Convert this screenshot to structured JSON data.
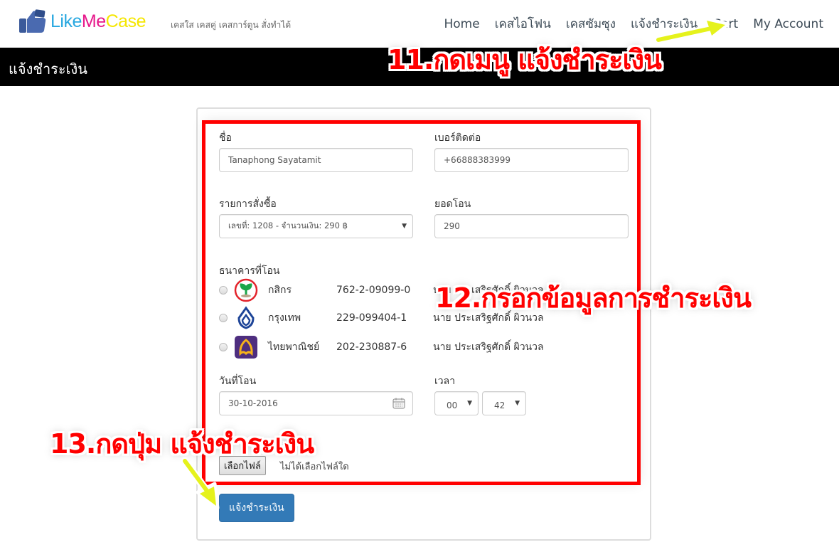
{
  "header": {
    "logo": {
      "part1": "Like",
      "part2": "Me",
      "part3": "Case"
    },
    "tagline": "เคสใส เคสคู่ เคสการ์ตูน สั่งทำได้",
    "nav": [
      {
        "label": "Home"
      },
      {
        "label": "เคสไอโฟน"
      },
      {
        "label": "เคสซัมซุง"
      },
      {
        "label": "แจ้งชำระเงิน"
      },
      {
        "label": "Cart"
      },
      {
        "label": "My Account"
      }
    ]
  },
  "page_title": "แจ้งชำระเงิน",
  "form": {
    "name": {
      "label": "ชื่อ",
      "value": "Tanaphong Sayatamit"
    },
    "phone": {
      "label": "เบอร์ติดต่อ",
      "value": "+66888383999"
    },
    "order": {
      "label": "รายการสั่งซื้อ",
      "selected": "เลขที่: 1208 - จำนวนเงิน: 290 ฿"
    },
    "amount": {
      "label": "ยอดโอน",
      "value": "290"
    },
    "bank": {
      "label": "ธนาคารที่โอน",
      "options": [
        {
          "name": "กสิกร",
          "account": "762-2-09099-0",
          "owner": "นาย ประเสริฐศักดิ์ ผิวนวล",
          "icon": "kbank-logo-icon",
          "color": "#1ba549"
        },
        {
          "name": "กรุงเทพ",
          "account": "229-099404-1",
          "owner": "นาย ประเสริฐศักดิ์ ผิวนวล",
          "icon": "bbl-logo-icon",
          "color": "#1e4598"
        },
        {
          "name": "ไทยพาณิชย์",
          "account": "202-230887-6",
          "owner": "นาย ประเสริฐศักดิ์ ผิวนวล",
          "icon": "scb-logo-icon",
          "color": "#4e2e7f"
        }
      ]
    },
    "date": {
      "label": "วันที่โอน",
      "value": "30-10-2016"
    },
    "time": {
      "label": "เวลา",
      "hour": "00",
      "minute": "42"
    },
    "file": {
      "button_label": "เลือกไฟล์",
      "status": "ไม่ได้เลือกไฟล์ใด"
    },
    "submit_label": "แจ้งชำระเงิน"
  },
  "annotations": {
    "step11": "11.กดเมนู แจ้งชำระเงิน",
    "step12": "12.กรอกข้อมูลการชำระเงิน",
    "step13": "13.กดปุ่ม แจ้งชำระเงิน",
    "box_color": "#ff0000",
    "arrow_color": "#e5f21c"
  },
  "colors": {
    "primary_button": "#337ab7",
    "title_bar": "#000000"
  }
}
